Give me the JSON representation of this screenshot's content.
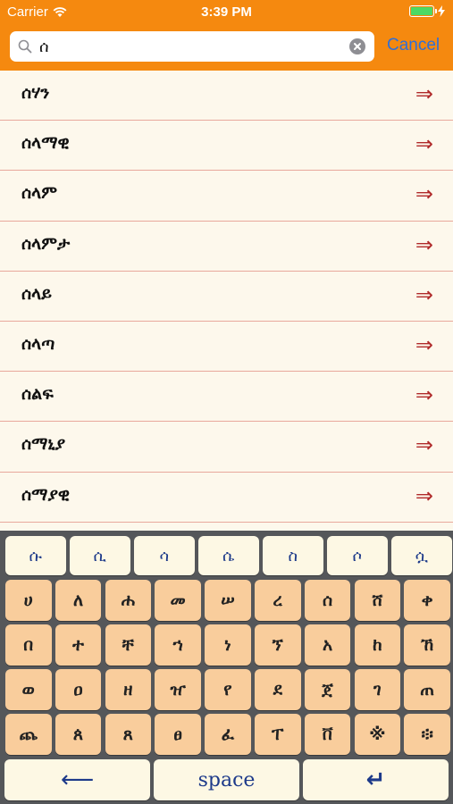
{
  "status_bar": {
    "carrier": "Carrier",
    "time": "3:39 PM",
    "battery_level": 1.0
  },
  "search": {
    "value": "ሰ",
    "cancel_label": "Cancel"
  },
  "results": [
    {
      "label": "ሰሃን",
      "arrow": "⇒"
    },
    {
      "label": "ሰላማዊ",
      "arrow": "⇒"
    },
    {
      "label": "ሰላም",
      "arrow": "⇒"
    },
    {
      "label": "ሰላምታ",
      "arrow": "⇒"
    },
    {
      "label": "ሰላይ",
      "arrow": "⇒"
    },
    {
      "label": "ሰላጣ",
      "arrow": "⇒"
    },
    {
      "label": "ሰልፍ",
      "arrow": "⇒"
    },
    {
      "label": "ሰማኒያ",
      "arrow": "⇒"
    },
    {
      "label": "ሰማያዊ",
      "arrow": "⇒"
    }
  ],
  "keyboard": {
    "vowel_row": [
      "ሱ",
      "ሲ",
      "ሳ",
      "ሴ",
      "ስ",
      "ሶ",
      "ሷ"
    ],
    "letter_rows": [
      [
        "ሀ",
        "ለ",
        "ሐ",
        "መ",
        "ሠ",
        "ረ",
        "ሰ",
        "ሸ",
        "ቀ"
      ],
      [
        "በ",
        "ተ",
        "ቸ",
        "ኀ",
        "ነ",
        "ኘ",
        "አ",
        "ከ",
        "ኸ"
      ],
      [
        "ወ",
        "ዐ",
        "ዘ",
        "ዠ",
        "የ",
        "ደ",
        "ጀ",
        "ገ",
        "ጠ"
      ],
      [
        "ጨ",
        "ጰ",
        "ጸ",
        "ፀ",
        "ፈ",
        "ፐ",
        "ቨ",
        "※",
        "፨"
      ]
    ],
    "backspace_symbol": "⟵",
    "space_label": "space",
    "return_symbol": "↵"
  },
  "colors": {
    "header": "#f5890f",
    "list_background": "#fdf8ec",
    "row_divider": "#e8a89c",
    "row_arrow": "#b02a2a",
    "key_letter": "#f9cd9c",
    "key_vowel": "#fdf8e4",
    "key_text_blue": "#1d3a8a",
    "cancel_text": "#2f6fd8"
  }
}
